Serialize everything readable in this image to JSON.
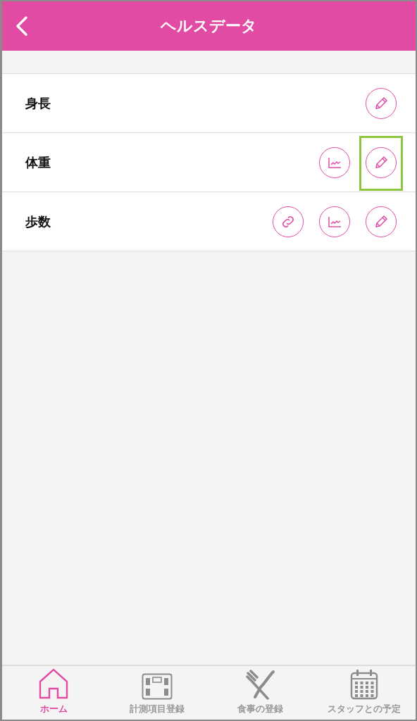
{
  "header": {
    "title": "ヘルスデータ"
  },
  "rows": [
    {
      "label": "身長",
      "actions": [
        {
          "kind": "edit",
          "highlighted": false
        }
      ]
    },
    {
      "label": "体重",
      "actions": [
        {
          "kind": "chart",
          "highlighted": false
        },
        {
          "kind": "edit",
          "highlighted": true
        }
      ]
    },
    {
      "label": "歩数",
      "actions": [
        {
          "kind": "link",
          "highlighted": false
        },
        {
          "kind": "chart",
          "highlighted": false
        },
        {
          "kind": "edit",
          "highlighted": false
        }
      ]
    }
  ],
  "tab_bar": [
    {
      "kind": "home",
      "label": "ホーム",
      "selected": true
    },
    {
      "kind": "scale",
      "label": "計測項目登録",
      "selected": false
    },
    {
      "kind": "meal",
      "label": "食事の登録",
      "selected": false
    },
    {
      "kind": "calendar",
      "label": "スタッフとの予定",
      "selected": false
    }
  ]
}
